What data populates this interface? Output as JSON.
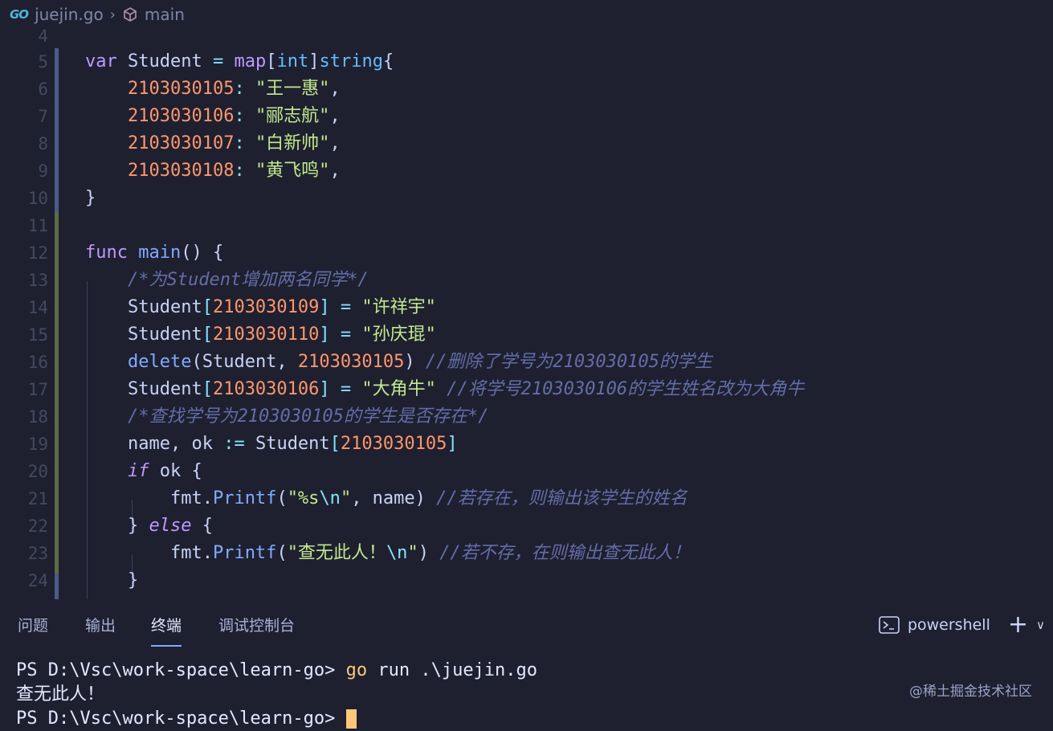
{
  "breadcrumb": {
    "lang_badge": "GO",
    "file": "juejin.go",
    "symbol": "main"
  },
  "editor": {
    "line_numbers": [
      "4",
      "5",
      "6",
      "7",
      "8",
      "9",
      "10",
      "11",
      "12",
      "13",
      "14",
      "15",
      "16",
      "17",
      "18",
      "19",
      "20",
      "21",
      "22",
      "23",
      "24"
    ]
  },
  "panel": {
    "tabs": [
      "问题",
      "输出",
      "终端",
      "调试控制台"
    ],
    "active_tab": "终端",
    "shell": "powershell",
    "add_label": "+",
    "chevron": "∨"
  },
  "terminal": {
    "prompt": "PS D:\\Vsc\\work-space\\learn-go> ",
    "command_go": "go",
    "command_rest": " run .\\juejin.go",
    "output": "查无此人！",
    "partial_prompt": "PS D:\\Vsc\\work-space\\learn-go> "
  },
  "watermark": "@稀土掘金技术社区",
  "colors": {
    "background": "#1e2030",
    "keyword": "#c099ff",
    "number": "#ff966c",
    "string": "#c3e88d",
    "function": "#82aaff",
    "comment": "#636da6",
    "gutter_modified": "#4d5a8a",
    "gutter_added": "#5b6b45"
  }
}
